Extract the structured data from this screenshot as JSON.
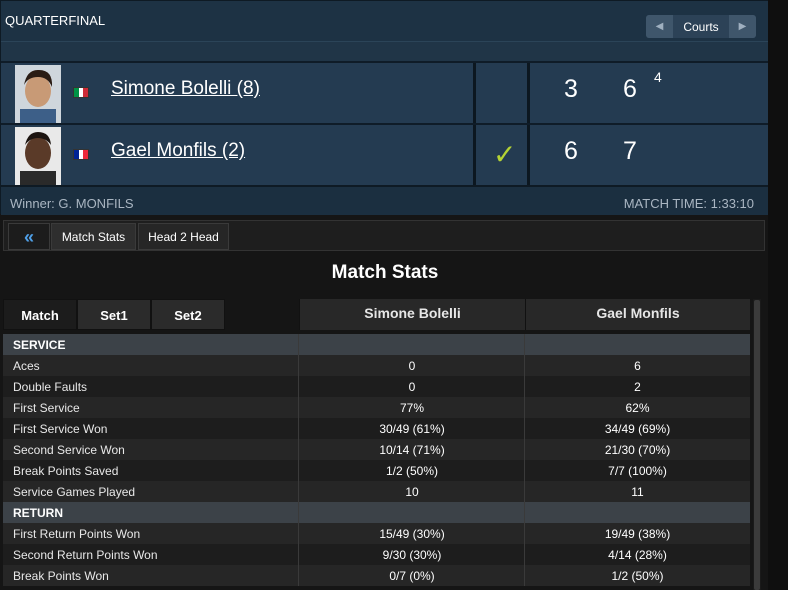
{
  "header": {
    "round": "QUARTERFINAL",
    "courts_label": "Courts",
    "left_arrow": "◀",
    "right_arrow": "▶"
  },
  "players": [
    {
      "name": "Simone Bolelli (8)",
      "flag_colors": [
        "#009246",
        "#ffffff",
        "#ce2b37"
      ],
      "sets": [
        "3",
        "6"
      ],
      "tiebreak": "4",
      "winner_mark": ""
    },
    {
      "name": "Gael Monfils (2)",
      "flag_colors": [
        "#002395",
        "#ffffff",
        "#ed2939"
      ],
      "sets": [
        "6",
        "7"
      ],
      "tiebreak": "",
      "winner_mark": "✓"
    }
  ],
  "footer": {
    "winner": "Winner: G. MONFILS",
    "match_time": "MATCH TIME: 1:33:10"
  },
  "tabs": {
    "back": "«",
    "match_stats": "Match Stats",
    "head2head": "Head 2 Head"
  },
  "stats_title": "Match Stats",
  "set_tabs": [
    "Match",
    "Set1",
    "Set2"
  ],
  "columns": [
    "Simone Bolelli",
    "Gael Monfils"
  ],
  "rows": [
    {
      "label": "SERVICE",
      "v1": "",
      "v2": "",
      "section": true
    },
    {
      "label": "Aces",
      "v1": "0",
      "v2": "6"
    },
    {
      "label": "Double Faults",
      "v1": "0",
      "v2": "2"
    },
    {
      "label": "First Service",
      "v1": "77%",
      "v2": "62%"
    },
    {
      "label": "First Service Won",
      "v1": "30/49 (61%)",
      "v2": "34/49 (69%)"
    },
    {
      "label": "Second Service Won",
      "v1": "10/14 (71%)",
      "v2": "21/30 (70%)"
    },
    {
      "label": "Break Points Saved",
      "v1": "1/2 (50%)",
      "v2": "7/7 (100%)"
    },
    {
      "label": "Service Games Played",
      "v1": "10",
      "v2": "11"
    },
    {
      "label": "RETURN",
      "v1": "",
      "v2": "",
      "section": true
    },
    {
      "label": "First Return Points Won",
      "v1": "15/49 (30%)",
      "v2": "19/49 (38%)"
    },
    {
      "label": "Second Return Points Won",
      "v1": "9/30 (30%)",
      "v2": "4/14 (28%)"
    },
    {
      "label": "Break Points Won",
      "v1": "0/7 (0%)",
      "v2": "1/2 (50%)"
    }
  ]
}
